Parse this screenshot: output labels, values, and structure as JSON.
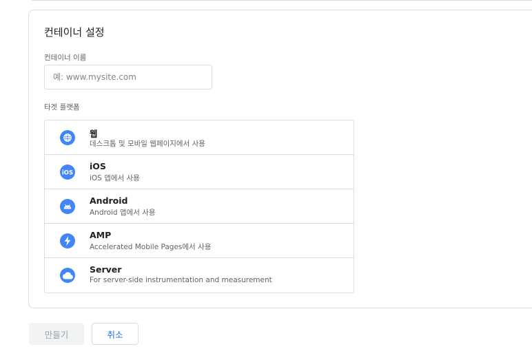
{
  "container_settings": {
    "title": "컨테이너 설정",
    "name_field": {
      "label": "컨테이너 이름",
      "placeholder": "예: www.mysite.com",
      "value": ""
    },
    "platform_label": "타겟 플랫폼",
    "platforms": [
      {
        "name": "웹",
        "description": "데스크톱 및 모바일 웹페이지에서 사용",
        "icon": "globe-icon"
      },
      {
        "name": "iOS",
        "description": "iOS 앱에서 사용",
        "icon": "ios-icon"
      },
      {
        "name": "Android",
        "description": "Android 앱에서 사용",
        "icon": "android-icon"
      },
      {
        "name": "AMP",
        "description": "Accelerated Mobile Pages에서 사용",
        "icon": "amp-bolt-icon"
      },
      {
        "name": "Server",
        "description": "For server-side instrumentation and measurement",
        "icon": "cloud-icon"
      }
    ],
    "icon_color": "#4285f4"
  },
  "actions": {
    "create_label": "만들기",
    "cancel_label": "취소"
  }
}
